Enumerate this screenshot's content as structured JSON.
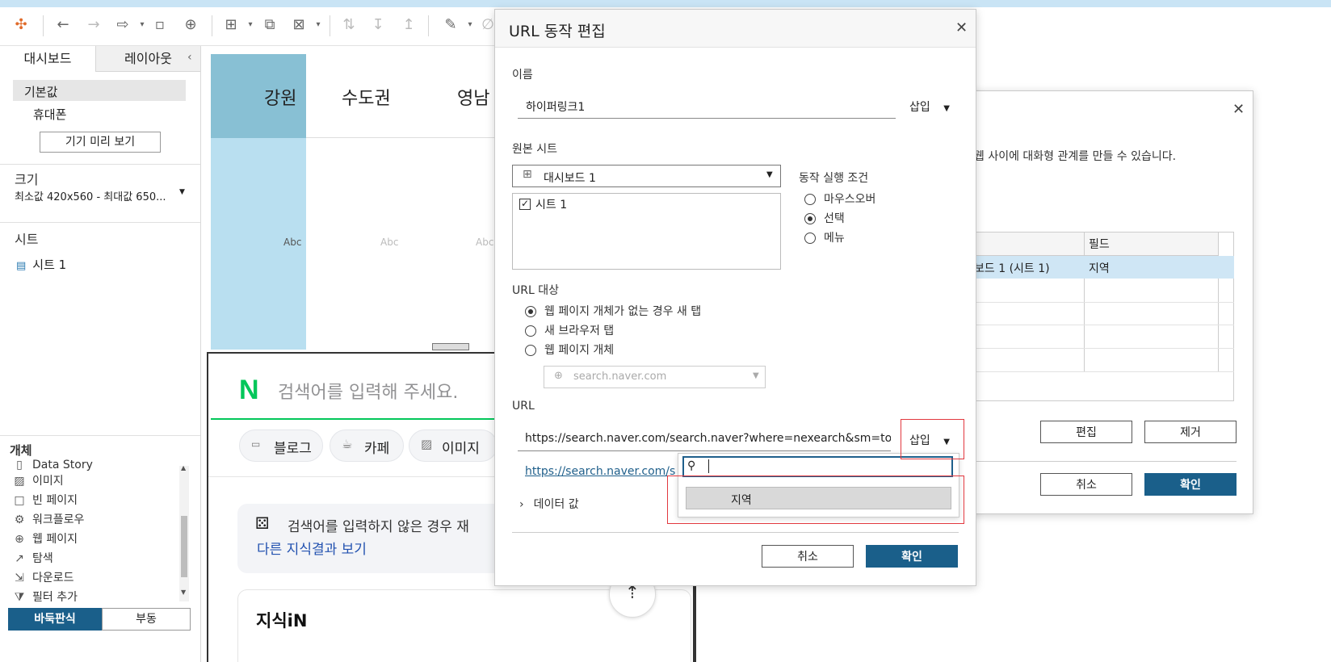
{
  "left_panel": {
    "tabs": [
      "대시보드",
      "레이아웃"
    ],
    "device": {
      "default": "기본값",
      "phone": "휴대폰",
      "preview_button": "기기 미리 보기"
    },
    "size": {
      "heading": "크기",
      "value": "최소값 420x560 - 최대값 650..."
    },
    "sheets": {
      "heading": "시트",
      "items": [
        "시트 1"
      ]
    },
    "objects": {
      "heading": "개체",
      "items": [
        "Data Story",
        "이미지",
        "빈 페이지",
        "워크플로우",
        "웹 페이지",
        "탐색",
        "다운로드",
        "필터 추가"
      ]
    },
    "layout_toggle": [
      "바둑판식",
      "부동"
    ]
  },
  "viz": {
    "headers": [
      "강원",
      "수도권",
      "영남"
    ],
    "cells": [
      "Abc",
      "Abc",
      "Abc"
    ]
  },
  "web_page": {
    "search_placeholder": "검색어를 입력해 주세요.",
    "chips": [
      "블로그",
      "카페",
      "이미지"
    ],
    "notice_text": "검색어를 입력하지 않은 경우 재",
    "notice_link": "다른 지식결과 보기",
    "kin_title": "지식iN"
  },
  "back_dialog": {
    "description": "웹 사이에 대화형 관계를 만들 수 있습니다.",
    "table_headers": [
      "",
      "필드"
    ],
    "table_row": [
      "보드 1 (시트 1)",
      "지역"
    ],
    "edit_button": "편집",
    "remove_button": "제거",
    "cancel_button": "취소",
    "ok_button": "확인"
  },
  "url_dialog": {
    "title": "URL 동작 편집",
    "name_label": "이름",
    "name_value": "하이퍼링크1",
    "insert_label": "삽입",
    "source_label": "원본 시트",
    "source_select": "대시보드 1",
    "source_checked_sheet": "시트 1",
    "run_condition_label": "동작 실행 조건",
    "run_options": [
      "마우스오버",
      "선택",
      "메뉴"
    ],
    "run_selected": "선택",
    "target_label": "URL 대상",
    "target_options": [
      "웹 페이지 개체가 없는 경우 새 탭",
      "새 브라우저 탭",
      "웹 페이지 개체"
    ],
    "target_selected": "웹 페이지 개체가 없는 경우 새 탭",
    "web_object_select": "search.naver.com",
    "url_label": "URL",
    "url_value": "https://search.naver.com/search.naver?where=nexearch&sm=top_",
    "url_link": "https://search.naver.com/s",
    "data_values_label": "데이터 값",
    "insert_dropdown_item": "지역",
    "cancel_button": "취소",
    "ok_button": "확인"
  },
  "colors": {
    "accent": "#1a5f8a",
    "highlight_red": "#e2383f",
    "viz_blue": "#b9dff0",
    "naver_green": "#03c75a"
  }
}
